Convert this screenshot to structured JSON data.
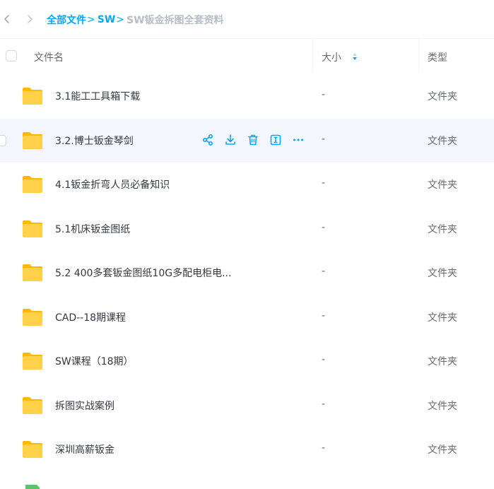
{
  "breadcrumb": {
    "items": [
      "全部文件",
      "SW"
    ],
    "separator": ">",
    "current": "SW钣金拆图全套资料"
  },
  "header": {
    "name": "文件名",
    "size": "大小",
    "type": "类型"
  },
  "files": [
    {
      "name": "3.1能工工具箱下载",
      "size": "-",
      "type": "文件夹"
    },
    {
      "name": "3.2.博士钣金琴剑",
      "size": "-",
      "type": "文件夹"
    },
    {
      "name": "4.1钣金折弯人员必备知识",
      "size": "-",
      "type": "文件夹"
    },
    {
      "name": "5.1机床钣金图纸",
      "size": "-",
      "type": "文件夹"
    },
    {
      "name": "5.2 400多套钣金图纸10G多配电柜电...",
      "size": "-",
      "type": "文件夹"
    },
    {
      "name": "CAD--18期课程",
      "size": "-",
      "type": "文件夹"
    },
    {
      "name": "SW课程（18期）",
      "size": "-",
      "type": "文件夹"
    },
    {
      "name": "拆图实战案例",
      "size": "-",
      "type": "文件夹"
    },
    {
      "name": "深圳高薪钣金",
      "size": "-",
      "type": "文件夹"
    }
  ],
  "hovered_row_index": 1,
  "row_actions": [
    "share-icon",
    "download-icon",
    "delete-icon",
    "rename-icon",
    "more-icon"
  ],
  "colors": {
    "accent": "#06a7ff",
    "folder_yellow": "#ffc933",
    "hover_bg": "#f3f7fd"
  }
}
